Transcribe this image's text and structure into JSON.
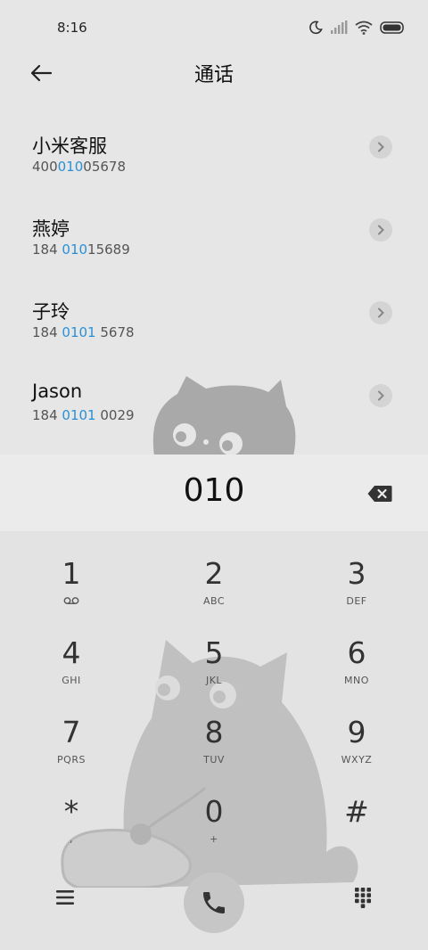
{
  "status_bar": {
    "time": "8:16"
  },
  "header": {
    "title": "通话"
  },
  "results": [
    {
      "name": "小米客服",
      "number_pre": "400",
      "number_match": "010",
      "number_post": "05678"
    },
    {
      "name": "燕婷",
      "number_pre": "184 ",
      "number_match": "010",
      "number_post": "15689"
    },
    {
      "name": "子玲",
      "number_pre": "184 ",
      "number_match": "0101",
      "number_post": " 5678"
    },
    {
      "name": "Jason",
      "number_pre": "184 ",
      "number_match": "0101",
      "number_post": " 0029"
    }
  ],
  "dialer": {
    "input_value": "010"
  },
  "keypad": {
    "keys": [
      {
        "digit": "1",
        "letters": ""
      },
      {
        "digit": "2",
        "letters": "ABC"
      },
      {
        "digit": "3",
        "letters": "DEF"
      },
      {
        "digit": "4",
        "letters": "GHI"
      },
      {
        "digit": "5",
        "letters": "JKL"
      },
      {
        "digit": "6",
        "letters": "MNO"
      },
      {
        "digit": "7",
        "letters": "PQRS"
      },
      {
        "digit": "8",
        "letters": "TUV"
      },
      {
        "digit": "9",
        "letters": "WXYZ"
      },
      {
        "digit": "*",
        "letters": ","
      },
      {
        "digit": "0",
        "letters": "+"
      },
      {
        "digit": "#",
        "letters": ""
      }
    ]
  },
  "colors": {
    "highlight": "#2a90d6",
    "background": "#e6e6e6"
  }
}
